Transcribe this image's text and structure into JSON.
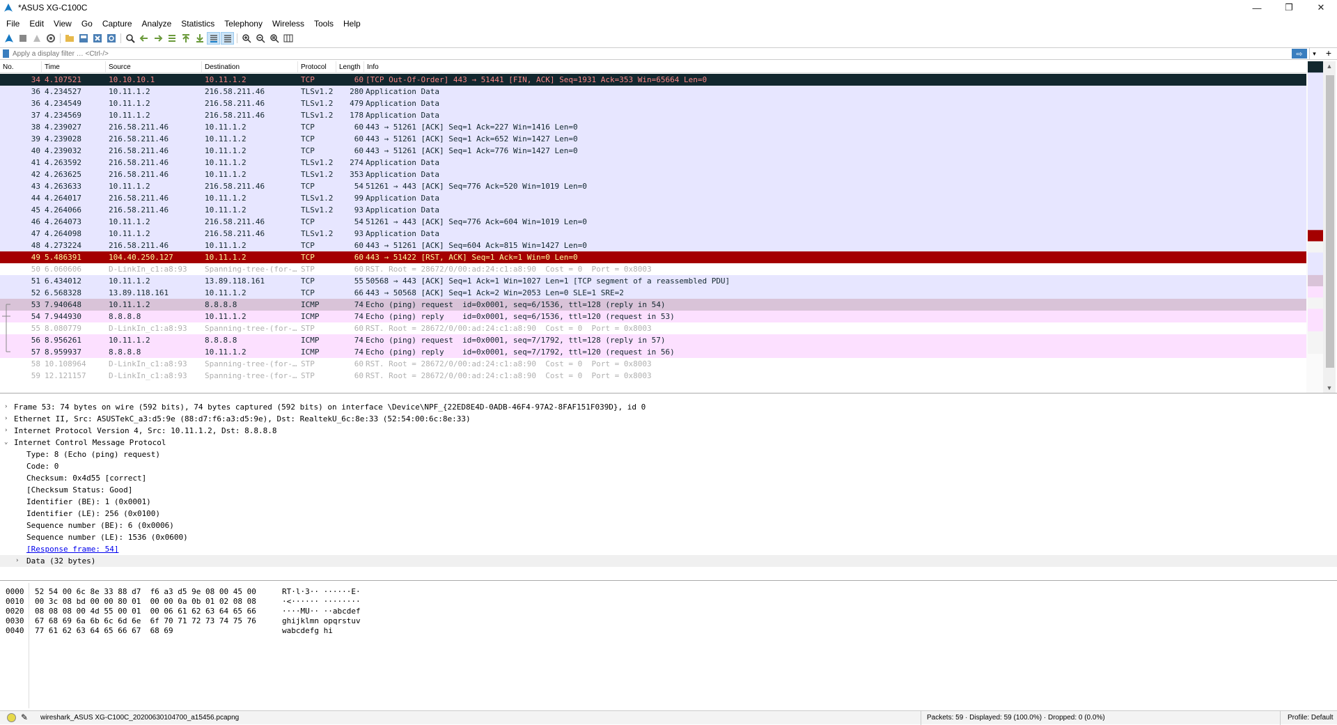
{
  "window": {
    "title": "*ASUS XG-C100C",
    "minimize": "—",
    "restore": "❐",
    "close": "✕"
  },
  "menu": [
    "File",
    "Edit",
    "View",
    "Go",
    "Capture",
    "Analyze",
    "Statistics",
    "Telephony",
    "Wireless",
    "Tools",
    "Help"
  ],
  "filter": {
    "placeholder": "Apply a display filter … <Ctrl-/>",
    "apply": "⇨",
    "dropdown": "▾",
    "add": "+"
  },
  "columns": {
    "no": "No.",
    "time": "Time",
    "source": "Source",
    "destination": "Destination",
    "protocol": "Protocol",
    "length": "Length",
    "info": "Info"
  },
  "packets": [
    {
      "no": "34",
      "time": "4.107521",
      "src": "10.10.10.1",
      "dst": "10.11.1.2",
      "proto": "TCP",
      "len": "60",
      "info": "[TCP Out-Of-Order] 443 → 51441 [FIN, ACK] Seq=1931 Ack=353 Win=65664 Len=0",
      "style": "bad-tcp"
    },
    {
      "no": "36",
      "time": "4.234527",
      "src": "10.11.1.2",
      "dst": "216.58.211.46",
      "proto": "TLSv1.2",
      "len": "280",
      "info": "Application Data",
      "style": "tcp"
    },
    {
      "no": "36",
      "time": "4.234549",
      "src": "10.11.1.2",
      "dst": "216.58.211.46",
      "proto": "TLSv1.2",
      "len": "479",
      "info": "Application Data",
      "style": "tcp"
    },
    {
      "no": "37",
      "time": "4.234569",
      "src": "10.11.1.2",
      "dst": "216.58.211.46",
      "proto": "TLSv1.2",
      "len": "178",
      "info": "Application Data",
      "style": "tcp"
    },
    {
      "no": "38",
      "time": "4.239027",
      "src": "216.58.211.46",
      "dst": "10.11.1.2",
      "proto": "TCP",
      "len": "60",
      "info": "443 → 51261 [ACK] Seq=1 Ack=227 Win=1416 Len=0",
      "style": "tcp"
    },
    {
      "no": "39",
      "time": "4.239028",
      "src": "216.58.211.46",
      "dst": "10.11.1.2",
      "proto": "TCP",
      "len": "60",
      "info": "443 → 51261 [ACK] Seq=1 Ack=652 Win=1427 Len=0",
      "style": "tcp"
    },
    {
      "no": "40",
      "time": "4.239032",
      "src": "216.58.211.46",
      "dst": "10.11.1.2",
      "proto": "TCP",
      "len": "60",
      "info": "443 → 51261 [ACK] Seq=1 Ack=776 Win=1427 Len=0",
      "style": "tcp"
    },
    {
      "no": "41",
      "time": "4.263592",
      "src": "216.58.211.46",
      "dst": "10.11.1.2",
      "proto": "TLSv1.2",
      "len": "274",
      "info": "Application Data",
      "style": "tcp"
    },
    {
      "no": "42",
      "time": "4.263625",
      "src": "216.58.211.46",
      "dst": "10.11.1.2",
      "proto": "TLSv1.2",
      "len": "353",
      "info": "Application Data",
      "style": "tcp"
    },
    {
      "no": "43",
      "time": "4.263633",
      "src": "10.11.1.2",
      "dst": "216.58.211.46",
      "proto": "TCP",
      "len": "54",
      "info": "51261 → 443 [ACK] Seq=776 Ack=520 Win=1019 Len=0",
      "style": "tcp"
    },
    {
      "no": "44",
      "time": "4.264017",
      "src": "216.58.211.46",
      "dst": "10.11.1.2",
      "proto": "TLSv1.2",
      "len": "99",
      "info": "Application Data",
      "style": "tcp"
    },
    {
      "no": "45",
      "time": "4.264066",
      "src": "216.58.211.46",
      "dst": "10.11.1.2",
      "proto": "TLSv1.2",
      "len": "93",
      "info": "Application Data",
      "style": "tcp"
    },
    {
      "no": "46",
      "time": "4.264073",
      "src": "10.11.1.2",
      "dst": "216.58.211.46",
      "proto": "TCP",
      "len": "54",
      "info": "51261 → 443 [ACK] Seq=776 Ack=604 Win=1019 Len=0",
      "style": "tcp"
    },
    {
      "no": "47",
      "time": "4.264098",
      "src": "10.11.1.2",
      "dst": "216.58.211.46",
      "proto": "TLSv1.2",
      "len": "93",
      "info": "Application Data",
      "style": "tcp"
    },
    {
      "no": "48",
      "time": "4.273224",
      "src": "216.58.211.46",
      "dst": "10.11.1.2",
      "proto": "TCP",
      "len": "60",
      "info": "443 → 51261 [ACK] Seq=604 Ack=815 Win=1427 Len=0",
      "style": "tcp"
    },
    {
      "no": "49",
      "time": "5.486391",
      "src": "104.40.250.127",
      "dst": "10.11.1.2",
      "proto": "TCP",
      "len": "60",
      "info": "443 → 51422 [RST, ACK] Seq=1 Ack=1 Win=0 Len=0",
      "style": "rst"
    },
    {
      "no": "50",
      "time": "6.060606",
      "src": "D-LinkIn_c1:a8:93",
      "dst": "Spanning-tree-(for-…",
      "proto": "STP",
      "len": "60",
      "info": "RST. Root = 28672/0/00:ad:24:c1:a8:90  Cost = 0  Port = 0x8003",
      "style": "stp"
    },
    {
      "no": "51",
      "time": "6.434012",
      "src": "10.11.1.2",
      "dst": "13.89.118.161",
      "proto": "TCP",
      "len": "55",
      "info": "50568 → 443 [ACK] Seq=1 Ack=1 Win=1027 Len=1 [TCP segment of a reassembled PDU]",
      "style": "tcp"
    },
    {
      "no": "52",
      "time": "6.568328",
      "src": "13.89.118.161",
      "dst": "10.11.1.2",
      "proto": "TCP",
      "len": "66",
      "info": "443 → 50568 [ACK] Seq=1 Ack=2 Win=2053 Len=0 SLE=1 SRE=2",
      "style": "tcp"
    },
    {
      "no": "53",
      "time": "7.940648",
      "src": "10.11.1.2",
      "dst": "8.8.8.8",
      "proto": "ICMP",
      "len": "74",
      "info": "Echo (ping) request  id=0x0001, seq=6/1536, ttl=128 (reply in 54)",
      "style": "icmp-sel"
    },
    {
      "no": "54",
      "time": "7.944930",
      "src": "8.8.8.8",
      "dst": "10.11.1.2",
      "proto": "ICMP",
      "len": "74",
      "info": "Echo (ping) reply    id=0x0001, seq=6/1536, ttl=120 (request in 53)",
      "style": "icmp"
    },
    {
      "no": "55",
      "time": "8.080779",
      "src": "D-LinkIn_c1:a8:93",
      "dst": "Spanning-tree-(for-…",
      "proto": "STP",
      "len": "60",
      "info": "RST. Root = 28672/0/00:ad:24:c1:a8:90  Cost = 0  Port = 0x8003",
      "style": "stp"
    },
    {
      "no": "56",
      "time": "8.956261",
      "src": "10.11.1.2",
      "dst": "8.8.8.8",
      "proto": "ICMP",
      "len": "74",
      "info": "Echo (ping) request  id=0x0001, seq=7/1792, ttl=128 (reply in 57)",
      "style": "icmp"
    },
    {
      "no": "57",
      "time": "8.959937",
      "src": "8.8.8.8",
      "dst": "10.11.1.2",
      "proto": "ICMP",
      "len": "74",
      "info": "Echo (ping) reply    id=0x0001, seq=7/1792, ttl=120 (request in 56)",
      "style": "icmp"
    },
    {
      "no": "58",
      "time": "10.108964",
      "src": "D-LinkIn_c1:a8:93",
      "dst": "Spanning-tree-(for-…",
      "proto": "STP",
      "len": "60",
      "info": "RST. Root = 28672/0/00:ad:24:c1:a8:90  Cost = 0  Port = 0x8003",
      "style": "stp"
    },
    {
      "no": "59",
      "time": "12.121157",
      "src": "D-LinkIn_c1:a8:93",
      "dst": "Spanning-tree-(for-…",
      "proto": "STP",
      "len": "60",
      "info": "RST. Root = 28672/0/00:ad:24:c1:a8:90  Cost = 0  Port = 0x8003",
      "style": "stp"
    }
  ],
  "details": [
    {
      "indent": 0,
      "twisty": "›",
      "text": "Frame 53: 74 bytes on wire (592 bits), 74 bytes captured (592 bits) on interface \\Device\\NPF_{22ED8E4D-0ADB-46F4-97A2-8FAF151F039D}, id 0"
    },
    {
      "indent": 0,
      "twisty": "›",
      "text": "Ethernet II, Src: ASUSTekC_a3:d5:9e (88:d7:f6:a3:d5:9e), Dst: RealtekU_6c:8e:33 (52:54:00:6c:8e:33)"
    },
    {
      "indent": 0,
      "twisty": "›",
      "text": "Internet Protocol Version 4, Src: 10.11.1.2, Dst: 8.8.8.8"
    },
    {
      "indent": 0,
      "twisty": "⌄",
      "text": "Internet Control Message Protocol"
    },
    {
      "indent": 1,
      "twisty": "",
      "text": "Type: 8 (Echo (ping) request)"
    },
    {
      "indent": 1,
      "twisty": "",
      "text": "Code: 0"
    },
    {
      "indent": 1,
      "twisty": "",
      "text": "Checksum: 0x4d55 [correct]"
    },
    {
      "indent": 1,
      "twisty": "",
      "text": "[Checksum Status: Good]"
    },
    {
      "indent": 1,
      "twisty": "",
      "text": "Identifier (BE): 1 (0x0001)"
    },
    {
      "indent": 1,
      "twisty": "",
      "text": "Identifier (LE): 256 (0x0100)"
    },
    {
      "indent": 1,
      "twisty": "",
      "text": "Sequence number (BE): 6 (0x0006)"
    },
    {
      "indent": 1,
      "twisty": "",
      "text": "Sequence number (LE): 1536 (0x0600)"
    },
    {
      "indent": 1,
      "twisty": "",
      "text": "[Response frame: 54]",
      "link": true
    },
    {
      "indent": 1,
      "twisty": "›",
      "text": "Data (32 bytes)",
      "hl": true
    }
  ],
  "bytes": [
    {
      "off": "0000",
      "hex": "52 54 00 6c 8e 33 88 d7  f6 a3 d5 9e 08 00 45 00",
      "ascii": "RT·l·3·· ······E·"
    },
    {
      "off": "0010",
      "hex": "00 3c 08 bd 00 00 80 01  00 00 0a 0b 01 02 08 08",
      "ascii": "·<······ ········"
    },
    {
      "off": "0020",
      "hex": "08 08 08 00 4d 55 00 01  00 06 61 62 63 64 65 66",
      "ascii": "····MU·· ··abcdef"
    },
    {
      "off": "0030",
      "hex": "67 68 69 6a 6b 6c 6d 6e  6f 70 71 72 73 74 75 76",
      "ascii": "ghijklmn opqrstuv"
    },
    {
      "off": "0040",
      "hex": "77 61 62 63 64 65 66 67  68 69",
      "ascii": "wabcdefg hi"
    }
  ],
  "status": {
    "file": "wireshark_ASUS XG-C100C_20200630104700_a15456.pcapng",
    "stats": "Packets: 59 · Displayed: 59 (100.0%) · Dropped: 0 (0.0%)",
    "profile": "Profile: Default"
  },
  "colors": {
    "tcp": "#e7e6ff",
    "rst": "#a40000",
    "bad": "#12272e",
    "icmp": "#fce0ff",
    "icmpsel": "#d9c3d8",
    "stp": "#fff"
  }
}
